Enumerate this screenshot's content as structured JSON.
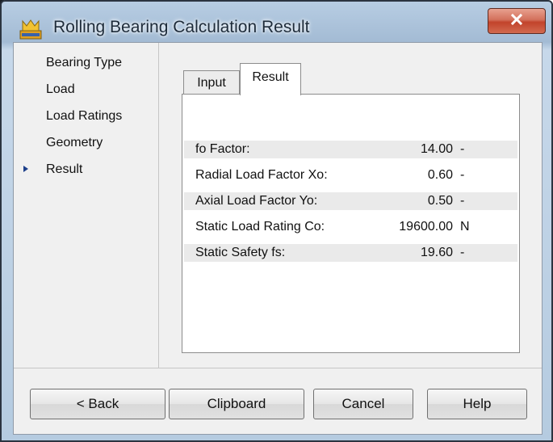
{
  "window": {
    "title": "Rolling Bearing Calculation Result"
  },
  "nav": {
    "items": [
      {
        "label": "Bearing Type"
      },
      {
        "label": "Load"
      },
      {
        "label": "Load Ratings"
      },
      {
        "label": "Geometry"
      },
      {
        "label": "Result",
        "selected": true
      }
    ]
  },
  "tabs": [
    {
      "label": "Input"
    },
    {
      "label": "Result",
      "active": true
    }
  ],
  "results": [
    {
      "label": "fo Factor:",
      "value": "14.00",
      "unit": "-"
    },
    {
      "label": "Radial Load Factor Xo:",
      "value": "0.60",
      "unit": "-"
    },
    {
      "label": "Axial Load Factor Yo:",
      "value": "0.50",
      "unit": "-"
    },
    {
      "label": "Static Load Rating Co:",
      "value": "19600.00",
      "unit": "N"
    },
    {
      "label": "Static Safety fs:",
      "value": "19.60",
      "unit": "-"
    }
  ],
  "buttons": {
    "back": "< Back",
    "clipboard": "Clipboard",
    "cancel": "Cancel",
    "help": "Help"
  },
  "icons": {
    "app": "app-logo-icon",
    "close": "close-icon",
    "selection_marker": "triangle-right-icon"
  },
  "colors": {
    "title_bar": "#b7cde3",
    "close_button": "#c2432b",
    "client_background": "#f0f0f0",
    "selection_marker": "#1d3f8a"
  }
}
